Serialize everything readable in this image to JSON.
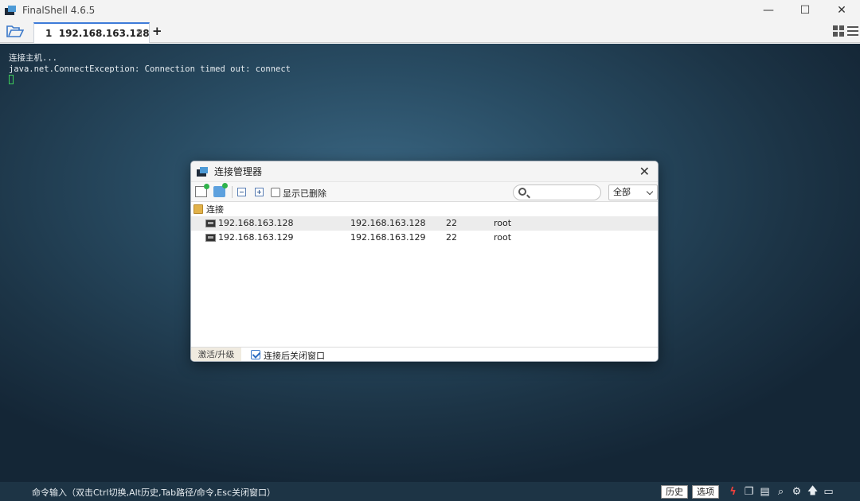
{
  "window": {
    "title": "FinalShell 4.6.5",
    "controls": {
      "minimize": "—",
      "maximize": "☐",
      "close": "✕"
    }
  },
  "tabs": [
    {
      "index": "1",
      "label": "192.168.163.128",
      "close": "✕"
    }
  ],
  "tab_add_label": "+",
  "terminal": {
    "lines": [
      "连接主机...",
      "java.net.ConnectException: Connection timed out: connect"
    ]
  },
  "dialog": {
    "title": "连接管理器",
    "close": "✕",
    "show_deleted_label": "显示已删除",
    "search_placeholder": "",
    "filter_selected": "全部",
    "group_name": "连接",
    "connections": [
      {
        "name": "192.168.163.128",
        "host": "192.168.163.128",
        "port": "22",
        "user": "root",
        "selected": true
      },
      {
        "name": "192.168.163.129",
        "host": "192.168.163.129",
        "port": "22",
        "user": "root",
        "selected": false
      }
    ],
    "footer": {
      "activate_label": "激活/升级",
      "close_after_connect_label": "连接后关闭窗口",
      "close_after_connect_checked": true
    }
  },
  "command_bar": {
    "hint": "命令输入（双击Ctrl切换,Alt历史,Tab路径/命令,Esc关闭窗口）",
    "history_label": "历史",
    "options_label": "选项"
  },
  "icons": {
    "flash": "ϟ",
    "copy": "❐",
    "paste": "▤",
    "search": "⌕",
    "settings": "⚙",
    "upload": "🡅",
    "window": "▭"
  },
  "colors": {
    "accent": "#3d7bd9",
    "tab_dot": "#e03b3b",
    "cursor": "#3ecf5a",
    "terminal_bg": "#284b62"
  }
}
